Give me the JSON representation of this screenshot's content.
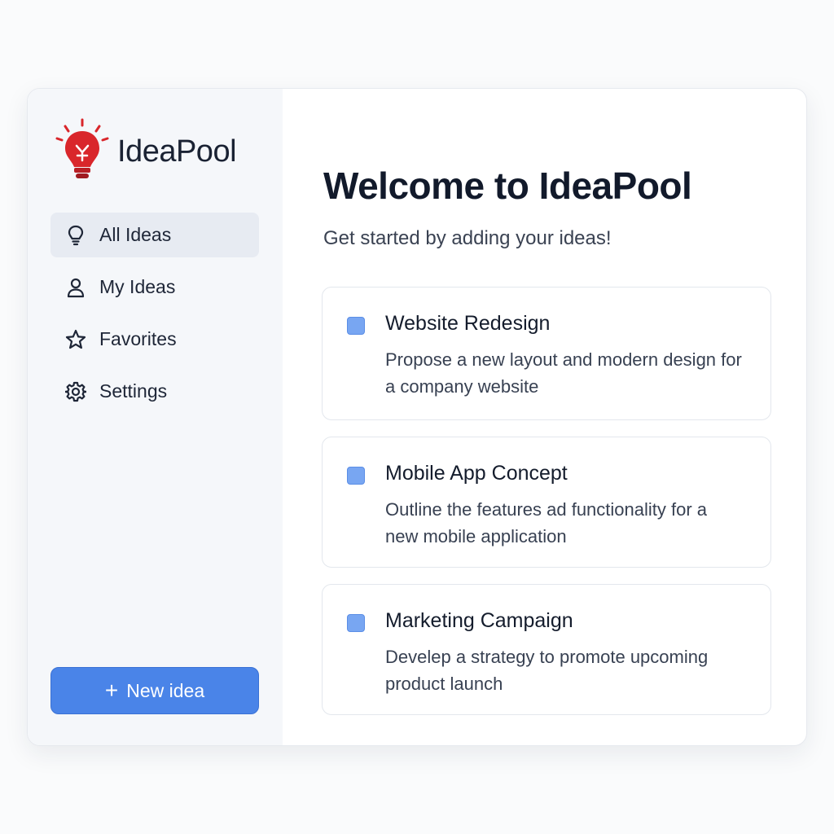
{
  "app": {
    "name": "IdeaPool"
  },
  "sidebar": {
    "items": [
      {
        "label": "All Ideas",
        "icon": "lightbulb-icon",
        "active": true
      },
      {
        "label": "My Ideas",
        "icon": "user-icon",
        "active": false
      },
      {
        "label": "Favorites",
        "icon": "star-icon",
        "active": false
      },
      {
        "label": "Settings",
        "icon": "gear-icon",
        "active": false
      }
    ],
    "new_button_label": "New idea"
  },
  "main": {
    "title": "Welcome to IdeaPool",
    "subtitle": "Get started by adding your ideas!",
    "cards": [
      {
        "title": "Website Redesign",
        "description": "Propose a new layout and modern design for a company website"
      },
      {
        "title": "Mobile App Concept",
        "description": "Outline the features ad functionality for a new mobile application"
      },
      {
        "title": "Marketing Campaign",
        "description": "Develep a strategy to promote upcoming product launch"
      }
    ]
  },
  "colors": {
    "accent": "#4a84e8",
    "logo": "#d9262b",
    "checkbox": "#78a6f2"
  }
}
